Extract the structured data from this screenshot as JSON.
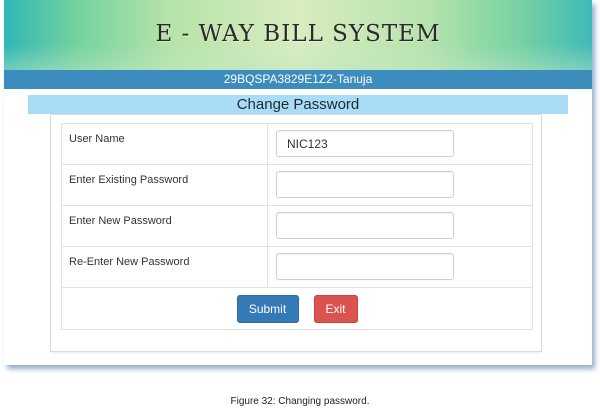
{
  "header": {
    "title": "E - WAY BILL SYSTEM",
    "user_id": "29BQSPA3829E1Z2-Tanuja"
  },
  "form": {
    "section_title": "Change Password",
    "fields": [
      {
        "label": "User Name",
        "value": "NIC123"
      },
      {
        "label": "Enter Existing Password",
        "value": ""
      },
      {
        "label": "Enter New Password",
        "value": ""
      },
      {
        "label": "Re-Enter New Password",
        "value": ""
      }
    ],
    "submit_label": "Submit",
    "exit_label": "Exit"
  },
  "caption": "Figure 32: Changing password.",
  "colors": {
    "user_strip": "#3c8dbd",
    "section_title_bg": "#a9dcf5",
    "submit_button": "#337ab7",
    "exit_button": "#d9534f"
  }
}
